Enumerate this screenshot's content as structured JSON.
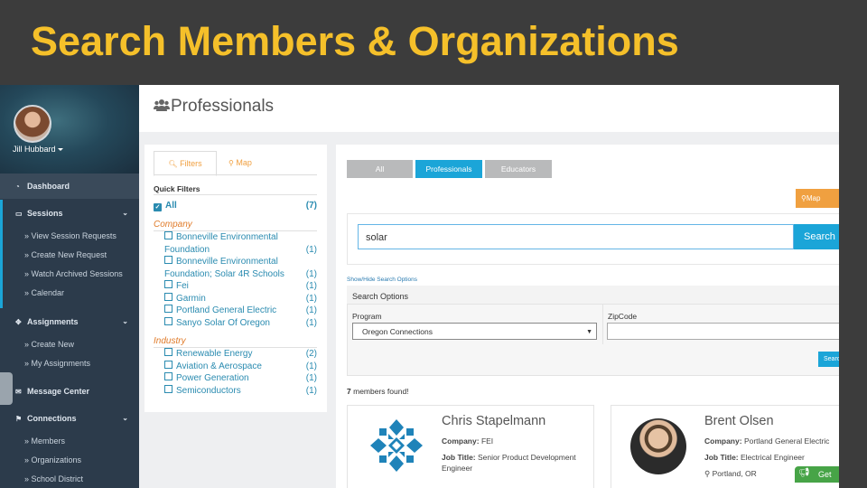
{
  "slide_title": "Search Members & Organizations",
  "sidebar": {
    "user_name": "Jill Hubbard",
    "items": [
      {
        "label": "Dashboard",
        "icon": "dashboard-icon"
      },
      {
        "label": "Sessions",
        "icon": "laptop-icon"
      },
      {
        "label": "View Session Requests"
      },
      {
        "label": "Create New Request"
      },
      {
        "label": "Watch Archived Sessions"
      },
      {
        "label": "Calendar"
      },
      {
        "label": "Assignments",
        "icon": "cubes-icon"
      },
      {
        "label": "Create New"
      },
      {
        "label": "My Assignments"
      },
      {
        "label": "Message Center",
        "icon": "envelope-icon"
      },
      {
        "label": "Connections",
        "icon": "flag-icon"
      },
      {
        "label": "Members"
      },
      {
        "label": "Organizations"
      },
      {
        "label": "School District"
      }
    ],
    "sub_prefix": "»"
  },
  "header": {
    "title": "Professionals",
    "icon": "users-icon"
  },
  "filters": {
    "tab_filters": "Filters",
    "tab_map": "Map",
    "quick_filters_label": "Quick Filters",
    "all_label": "All",
    "all_count": "(7)",
    "company_title": "Company",
    "company": [
      {
        "label": "Bonneville Environmental Foundation",
        "count": "(1)"
      },
      {
        "label": "Bonneville Environmental Foundation; Solar 4R Schools",
        "count": "(1)"
      },
      {
        "label": "Fei",
        "count": "(1)"
      },
      {
        "label": "Garmin",
        "count": "(1)"
      },
      {
        "label": "Portland General Electric",
        "count": "(1)"
      },
      {
        "label": "Sanyo Solar Of Oregon",
        "count": "(1)"
      }
    ],
    "industry_title": "Industry",
    "industry": [
      {
        "label": "Renewable Energy",
        "count": "(2)"
      },
      {
        "label": "Aviation & Aerospace",
        "count": "(1)"
      },
      {
        "label": "Power Generation",
        "count": "(1)"
      },
      {
        "label": "Semiconductors",
        "count": "(1)"
      }
    ]
  },
  "main": {
    "pills": [
      "All",
      "Professionals",
      "Educators"
    ],
    "map_button": "Map",
    "search_value": "solar",
    "search_button": "Search",
    "show_hide": "Show/Hide Search Options",
    "search_options_title": "Search Options",
    "program_label": "Program",
    "program_value": "Oregon Connections",
    "zipcode_label": "ZipCode",
    "options_search_button": "Search",
    "found_count": "7",
    "found_text": "members found!",
    "cards": [
      {
        "name": "Chris Stapelmann",
        "company_label": "Company:",
        "company": "FEI",
        "job_label": "Job Title:",
        "job_title": "Senior Product Development Engineer"
      },
      {
        "name": "Brent Olsen",
        "company_label": "Company:",
        "company": "Portland General Electric",
        "job_label": "Job Title:",
        "job_title": "Electrical Engineer",
        "location": "Portland, OR"
      }
    ]
  },
  "feedback_button": "Get St",
  "colors": {
    "title": "#f5c02a",
    "accent": "#1ba5d8",
    "orange": "#f0a040",
    "link": "#2a8bb0",
    "sidebar": "#2c3b4b"
  }
}
